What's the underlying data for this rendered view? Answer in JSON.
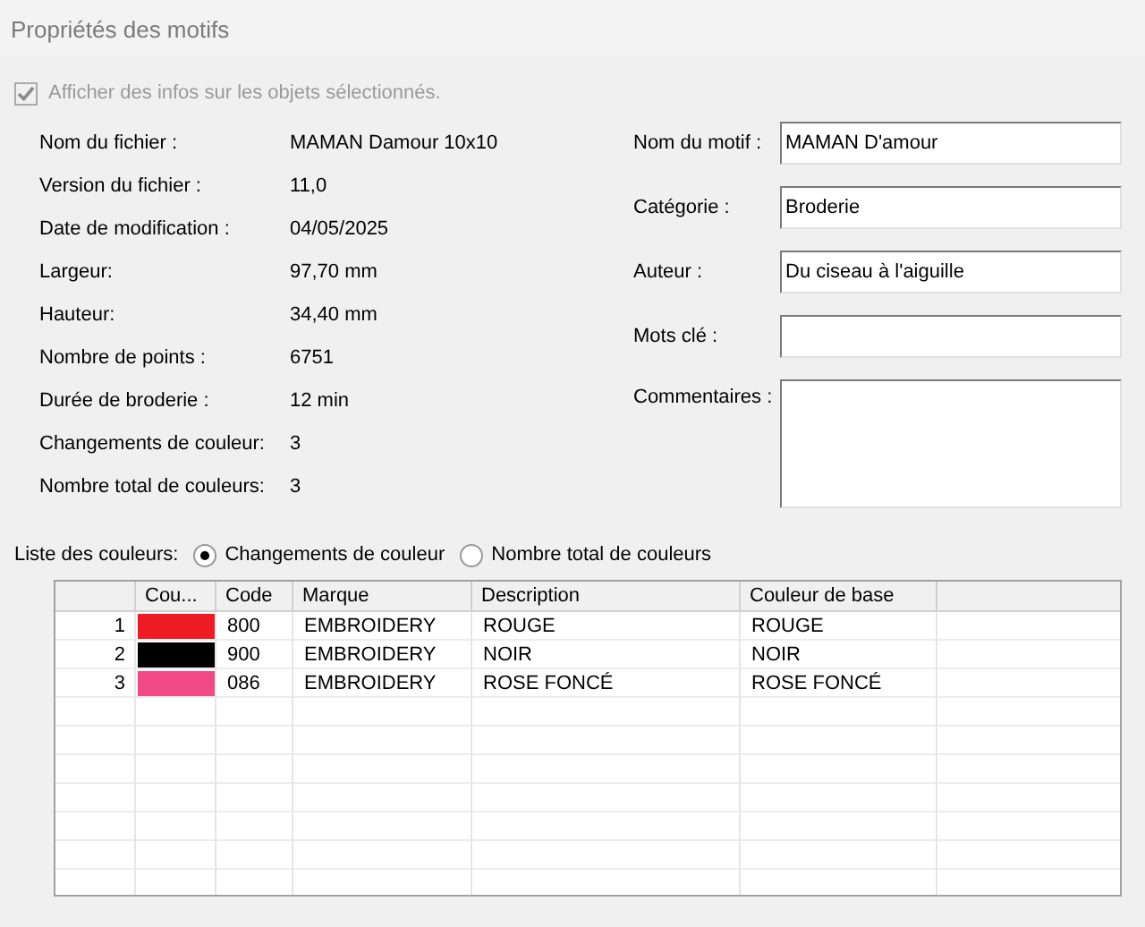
{
  "window": {
    "title": "Propriétés des motifs"
  },
  "show_info": {
    "label": "Afficher des infos sur les objets sélectionnés.",
    "checked": true,
    "disabled": true
  },
  "info": [
    {
      "label": "Nom du fichier :",
      "value": "MAMAN Damour 10x10"
    },
    {
      "label": "Version du fichier :",
      "value": "11,0"
    },
    {
      "label": "Date de modification :",
      "value": "04/05/2025"
    },
    {
      "label": "Largeur:",
      "value": "97,70 mm"
    },
    {
      "label": "Hauteur:",
      "value": "34,40 mm"
    },
    {
      "label": "Nombre de points :",
      "value": "6751"
    },
    {
      "label": "Durée de broderie :",
      "value": "12 min"
    },
    {
      "label": "Changements de couleur:",
      "value": "3"
    },
    {
      "label": "Nombre total de couleurs:",
      "value": "3"
    }
  ],
  "fields": [
    {
      "label": "Nom du motif :",
      "value": "MAMAN D'amour"
    },
    {
      "label": "Catégorie :",
      "value": "Broderie"
    },
    {
      "label": "Auteur :",
      "value": "Du ciseau à l'aiguille"
    },
    {
      "label": "Mots clé :"
    }
  ],
  "comments": {
    "label": "Commentaires :"
  },
  "color_list": {
    "label": "Liste des couleurs:",
    "options": [
      {
        "label": "Changements de couleur",
        "selected": true
      },
      {
        "label": "Nombre total de couleurs",
        "selected": false
      }
    ]
  },
  "table": {
    "columns": [
      "Cou...",
      "Code",
      "Marque",
      "Description",
      "Couleur de base"
    ],
    "rows": [
      {
        "number": "1",
        "color": "#ed1c24",
        "code": "800",
        "brand": "EMBROIDERY",
        "description": "ROUGE",
        "base": "ROUGE"
      },
      {
        "number": "2",
        "color": "#000000",
        "code": "900",
        "brand": "EMBROIDERY",
        "description": "NOIR",
        "base": "NOIR"
      },
      {
        "number": "3",
        "color": "#f24a86",
        "code": "086",
        "brand": "EMBROIDERY",
        "description": "ROSE FONCÉ",
        "base": "ROSE FONCÉ"
      }
    ]
  }
}
